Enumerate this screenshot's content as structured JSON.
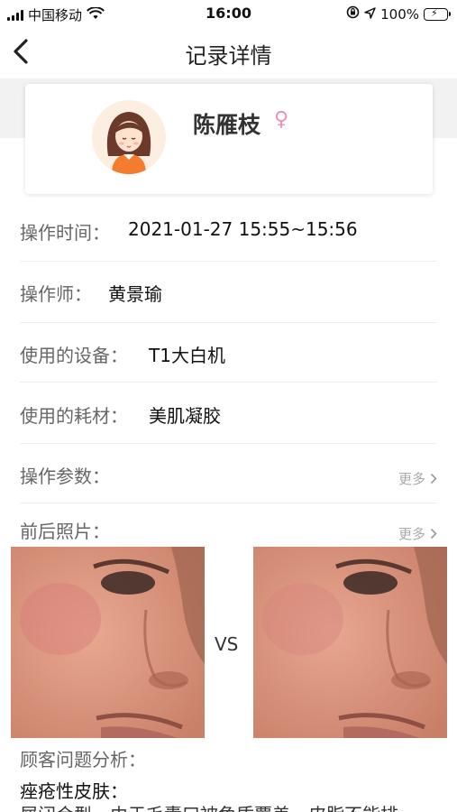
{
  "status_bar": {
    "carrier": "中国移动",
    "time": "16:00",
    "battery": "100%",
    "icons": [
      "signal-icon",
      "wifi-icon",
      "orientation-lock-icon",
      "location-icon",
      "battery-charging-icon"
    ]
  },
  "nav": {
    "title": "记录详情",
    "back_icon": "chevron-left-icon"
  },
  "profile": {
    "name": "陈雁枝",
    "gender_symbol": "♀",
    "gender_color": "#f08fb3"
  },
  "details": [
    {
      "label": "操作时间：",
      "value": "2021-01-27 15:55~15:56"
    },
    {
      "label": "操作师：",
      "value": "黄景瑜"
    },
    {
      "label": "使用的设备：",
      "value": "T1大白机"
    },
    {
      "label": "使用的耗材：",
      "value": "美肌凝胶"
    }
  ],
  "params": {
    "label": "操作参数：",
    "more": "更多"
  },
  "photos": {
    "label": "前后照片：",
    "more": "更多",
    "vs": "VS"
  },
  "analysis": {
    "title": "顾客问题分析：",
    "skin_type": "痤疮性皮肤：",
    "description": "屑闭合型，由于毛囊口被角质覆盖，皮脂不能排"
  }
}
